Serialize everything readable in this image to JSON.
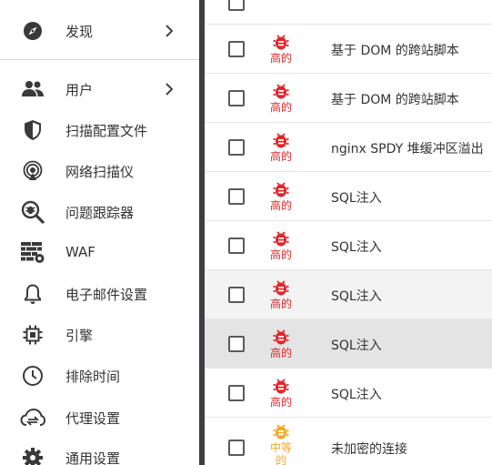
{
  "sidebar": {
    "items": [
      {
        "label": "发现",
        "icon": "compass-icon",
        "has_chevron": true
      },
      {
        "label": "用户",
        "icon": "users-icon",
        "has_chevron": true
      },
      {
        "label": "扫描配置文件",
        "icon": "shield-icon",
        "has_chevron": false
      },
      {
        "label": "网络扫描仪",
        "icon": "radar-icon",
        "has_chevron": false
      },
      {
        "label": "问题跟踪器",
        "icon": "bug-search-icon",
        "has_chevron": false
      },
      {
        "label": "WAF",
        "icon": "firewall-icon",
        "has_chevron": false
      },
      {
        "label": "电子邮件设置",
        "icon": "bell-icon",
        "has_chevron": false
      },
      {
        "label": "引擎",
        "icon": "chip-icon",
        "has_chevron": false
      },
      {
        "label": "排除时间",
        "icon": "clock-icon",
        "has_chevron": false
      },
      {
        "label": "代理设置",
        "icon": "cloud-sync-icon",
        "has_chevron": false
      },
      {
        "label": "通用设置",
        "icon": "gear-icon",
        "has_chevron": false
      }
    ]
  },
  "colors": {
    "high": "#e0262b",
    "medium": "#f5a623",
    "sidebar_edge": "#3d3f45"
  },
  "vulnerabilities": [
    {
      "severity": "高的",
      "level": "high",
      "name": "基于 DOM 的跨站脚本"
    },
    {
      "severity": "高的",
      "level": "high",
      "name": "基于 DOM 的跨站脚本"
    },
    {
      "severity": "高的",
      "level": "high",
      "name": "nginx SPDY 堆缓冲区溢出"
    },
    {
      "severity": "高的",
      "level": "high",
      "name": "SQL注入"
    },
    {
      "severity": "高的",
      "level": "high",
      "name": "SQL注入"
    },
    {
      "severity": "高的",
      "level": "high",
      "name": "SQL注入"
    },
    {
      "severity": "高的",
      "level": "high",
      "name": "SQL注入"
    },
    {
      "severity": "高的",
      "level": "high",
      "name": "SQL注入"
    },
    {
      "severity": "中等的",
      "level": "medium",
      "name": "未加密的连接"
    }
  ]
}
